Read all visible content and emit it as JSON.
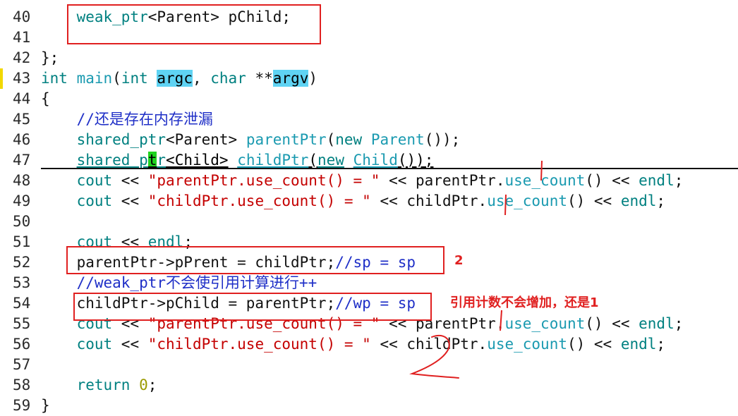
{
  "editor": {
    "lines": [
      {
        "num": "40",
        "tokens": [
          {
            "t": "    "
          },
          {
            "t": "weak_ptr",
            "c": "kw"
          },
          {
            "t": "<Parent> pChild;"
          }
        ]
      },
      {
        "num": "41",
        "tokens": []
      },
      {
        "num": "42",
        "tokens": [
          {
            "t": "};"
          }
        ]
      },
      {
        "num": "43",
        "tokens": [
          {
            "t": "int ",
            "c": "kw"
          },
          {
            "t": "main",
            "c": "fn"
          },
          {
            "t": "("
          },
          {
            "t": "int ",
            "c": "kw"
          },
          {
            "t": "argc",
            "c": "hl"
          },
          {
            "t": ", "
          },
          {
            "t": "char ",
            "c": "kw"
          },
          {
            "t": "**"
          },
          {
            "t": "argv",
            "c": "hl"
          },
          {
            "t": ")"
          }
        ]
      },
      {
        "num": "44",
        "tokens": [
          {
            "t": "{"
          }
        ]
      },
      {
        "num": "45",
        "tokens": [
          {
            "t": "    "
          },
          {
            "t": "//还是存在内存泄漏",
            "c": "cmt"
          }
        ]
      },
      {
        "num": "46",
        "tokens": [
          {
            "t": "    "
          },
          {
            "t": "shared_ptr",
            "c": "kw"
          },
          {
            "t": "<Parent> "
          },
          {
            "t": "parentPtr",
            "c": "fn"
          },
          {
            "t": "("
          },
          {
            "t": "new ",
            "c": "kw"
          },
          {
            "t": "Parent",
            "c": "cls"
          },
          {
            "t": "());"
          }
        ]
      },
      {
        "num": "47",
        "tokens": [
          {
            "t": "    "
          },
          {
            "t": "shared_p",
            "c": "kw u"
          },
          {
            "t": "t",
            "c": "cursor u"
          },
          {
            "t": "r",
            "c": "kw u"
          },
          {
            "t": "<Child>",
            "c": "u"
          },
          {
            "t": " "
          },
          {
            "t": "childPtr",
            "c": "fn u"
          },
          {
            "t": "(",
            "c": "u"
          },
          {
            "t": "new",
            "c": "kw u"
          },
          {
            "t": " "
          },
          {
            "t": "Child",
            "c": "cls u"
          },
          {
            "t": "());",
            "c": "u"
          }
        ]
      },
      {
        "num": "48",
        "tokens": [
          {
            "t": "    "
          },
          {
            "t": "cout",
            "c": "kw"
          },
          {
            "t": " << "
          },
          {
            "t": "\"parentPtr.use_count() = \"",
            "c": "str"
          },
          {
            "t": " << parentPtr."
          },
          {
            "t": "use_count",
            "c": "fn"
          },
          {
            "t": "() << "
          },
          {
            "t": "endl",
            "c": "kw"
          },
          {
            "t": ";"
          }
        ]
      },
      {
        "num": "49",
        "tokens": [
          {
            "t": "    "
          },
          {
            "t": "cout",
            "c": "kw"
          },
          {
            "t": " << "
          },
          {
            "t": "\"childPtr.use_count() = \"",
            "c": "str"
          },
          {
            "t": " << childPtr."
          },
          {
            "t": "use_count",
            "c": "fn"
          },
          {
            "t": "() << "
          },
          {
            "t": "endl",
            "c": "kw"
          },
          {
            "t": ";"
          }
        ]
      },
      {
        "num": "50",
        "tokens": []
      },
      {
        "num": "51",
        "tokens": [
          {
            "t": "    "
          },
          {
            "t": "cout",
            "c": "kw"
          },
          {
            "t": " << "
          },
          {
            "t": "endl",
            "c": "kw"
          },
          {
            "t": ";"
          }
        ]
      },
      {
        "num": "52",
        "tokens": [
          {
            "t": "    parentPtr->pPrent = childPtr;"
          },
          {
            "t": "//sp = sp",
            "c": "cmt"
          }
        ]
      },
      {
        "num": "53",
        "tokens": [
          {
            "t": "    "
          },
          {
            "t": "//weak_ptr不会使引用计算进行++",
            "c": "cmt"
          }
        ]
      },
      {
        "num": "54",
        "tokens": [
          {
            "t": "    childPtr->pChild = parentPtr;"
          },
          {
            "t": "//wp = sp",
            "c": "cmt"
          }
        ]
      },
      {
        "num": "55",
        "tokens": [
          {
            "t": "    "
          },
          {
            "t": "cout",
            "c": "kw"
          },
          {
            "t": " << "
          },
          {
            "t": "\"parentPtr.use_count() = \"",
            "c": "str"
          },
          {
            "t": " << parentPtr."
          },
          {
            "t": "use_count",
            "c": "fn"
          },
          {
            "t": "() << "
          },
          {
            "t": "endl",
            "c": "kw"
          },
          {
            "t": ";"
          }
        ]
      },
      {
        "num": "56",
        "tokens": [
          {
            "t": "    "
          },
          {
            "t": "cout",
            "c": "kw"
          },
          {
            "t": " << "
          },
          {
            "t": "\"childPtr.use_count() = \"",
            "c": "str"
          },
          {
            "t": " << childPtr."
          },
          {
            "t": "use_count",
            "c": "fn"
          },
          {
            "t": "() << "
          },
          {
            "t": "endl",
            "c": "kw"
          },
          {
            "t": ";"
          }
        ]
      },
      {
        "num": "57",
        "tokens": []
      },
      {
        "num": "58",
        "tokens": [
          {
            "t": "    "
          },
          {
            "t": "return ",
            "c": "kw"
          },
          {
            "t": "0",
            "c": "num"
          },
          {
            "t": ";"
          }
        ]
      },
      {
        "num": "59",
        "tokens": [
          {
            "t": "}"
          }
        ]
      }
    ]
  },
  "annotations": {
    "label_2": "2",
    "note": "引用计数不会增加，还是1"
  },
  "colors": {
    "annotation": "#e02020",
    "keyword": "#008080",
    "comment": "#1f2fc7",
    "string": "#c40000",
    "highlight": "#5fd3f3",
    "cursor": "#1fd31f"
  }
}
